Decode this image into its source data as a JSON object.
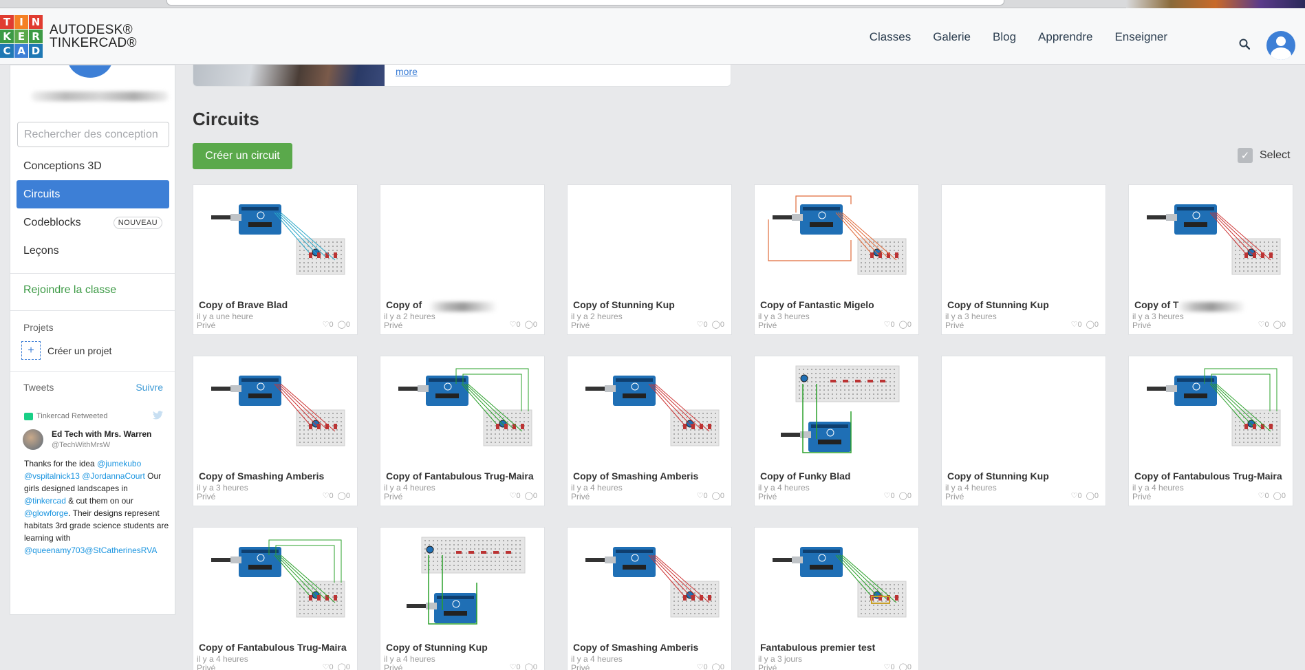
{
  "colors": {
    "accent_blue": "#3d7fd6",
    "primary_green": "#5aa94b",
    "join_green": "#3c9a45"
  },
  "logo": {
    "letters": [
      "T",
      "I",
      "N",
      "K",
      "E",
      "R",
      "C",
      "A",
      "D"
    ],
    "colors": [
      "#e03c31",
      "#f58025",
      "#e03c31",
      "#3c9a45",
      "#5aa94b",
      "#3c9a45",
      "#1f78b4",
      "#3d7fd6",
      "#1f78b4"
    ],
    "brand_line1": "AUTODESK®",
    "brand_line2": "TINKERCAD®"
  },
  "nav": {
    "links": [
      "Classes",
      "Galerie",
      "Blog",
      "Apprendre",
      "Enseigner"
    ],
    "search_icon": "search-icon",
    "avatar_icon": "user-avatar-icon"
  },
  "sidebar": {
    "search_placeholder": "Rechercher des conception",
    "items": [
      {
        "label": "Conceptions 3D"
      },
      {
        "label": "Circuits"
      },
      {
        "label": "Codeblocks",
        "badge": "NOUVEAU"
      },
      {
        "label": "Leçons"
      }
    ],
    "join_class": "Rejoindre la classe",
    "projects_label": "Projets",
    "create_project": "Créer un projet",
    "tweets_label": "Tweets",
    "follow_label": "Suivre",
    "tweet": {
      "retweet_line": "Tinkercad Retweeted",
      "user_name": "Ed Tech with Mrs. Warren",
      "user_handle": "@TechWithMrsW",
      "text_1": "Thanks for the idea ",
      "link_1": "@jumekubo",
      "link_2": "@vspitalnick13",
      "link_3": "@JordannaCourt",
      "text_2": " Our girls designed landscapes in ",
      "link_4": "@tinkercad",
      "text_3": " & cut them on our ",
      "link_5": "@glowforge",
      "text_4": ". Their designs represent habitats 3rd grade science students are learning with ",
      "link_6": "@queenamy703@StCatherinesRVA"
    }
  },
  "main": {
    "banner_more": "more",
    "title": "Circuits",
    "create_button": "Créer un circuit",
    "select_label": "Select",
    "private_label": "Privé",
    "likes": "0",
    "comments": "0",
    "cards": [
      {
        "title": "Copy of Brave Blad",
        "time": "il y a une heure",
        "thumb": "uno-blue"
      },
      {
        "title": "Copy of",
        "time": "il y a 2 heures",
        "thumb": "blank",
        "blurred": true
      },
      {
        "title": "Copy of Stunning Kup",
        "time": "il y a 2 heures",
        "thumb": "blank"
      },
      {
        "title": "Copy of Fantastic Migelo",
        "time": "il y a 3 heures",
        "thumb": "uno-orange"
      },
      {
        "title": "Copy of Stunning Kup",
        "time": "il y a 3 heures",
        "thumb": "blank"
      },
      {
        "title": "Copy of T",
        "time": "il y a 3 heures",
        "thumb": "uno-red",
        "blurred": true
      },
      {
        "title": "Copy of Smashing Amberis",
        "time": "il y a 3 heures",
        "thumb": "uno-red"
      },
      {
        "title": "Copy of Fantabulous Trug-Maira",
        "time": "il y a 4 heures",
        "thumb": "uno-green"
      },
      {
        "title": "Copy of Smashing Amberis",
        "time": "il y a 4 heures",
        "thumb": "uno-red"
      },
      {
        "title": "Copy of Funky Blad",
        "time": "il y a 4 heures",
        "thumb": "uno-top"
      },
      {
        "title": "Copy of Stunning Kup",
        "time": "il y a 4 heures",
        "thumb": "blank"
      },
      {
        "title": "Copy of Fantabulous Trug-Maira",
        "time": "il y a 4 heures",
        "thumb": "uno-green"
      },
      {
        "title": "Copy of Fantabulous Trug-Maira",
        "time": "il y a 4 heures",
        "thumb": "uno-green"
      },
      {
        "title": "Copy of Stunning Kup",
        "time": "il y a 4 heures",
        "thumb": "uno-top"
      },
      {
        "title": "Copy of Smashing Amberis",
        "time": "il y a 4 heures",
        "thumb": "uno-red"
      },
      {
        "title": "Fantabulous premier test",
        "time": "il y a 3 jours",
        "thumb": "uno-yellow"
      }
    ]
  }
}
